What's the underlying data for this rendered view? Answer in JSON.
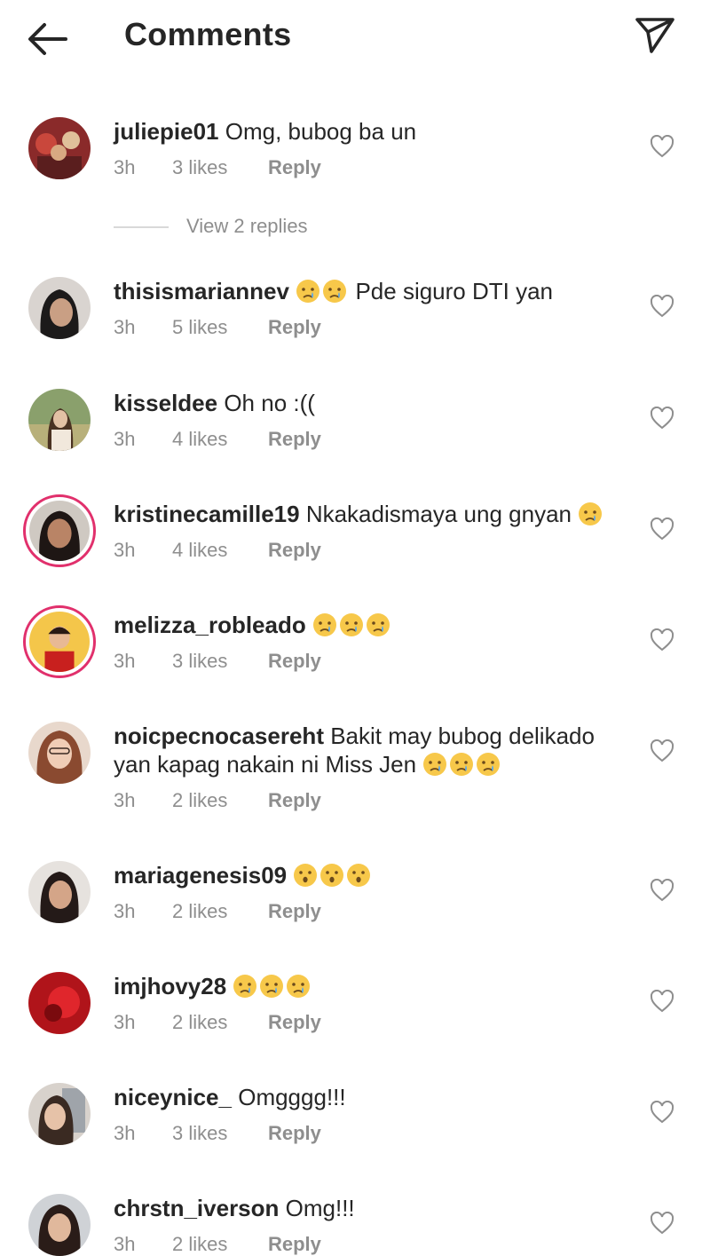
{
  "header": {
    "title": "Comments",
    "back_icon": "arrow-left-icon",
    "send_icon": "paper-plane-icon"
  },
  "comments": [
    {
      "username": "juliepie01",
      "text": "Omg, bubog ba un",
      "emojis": 0,
      "emoji_type": "",
      "time": "3h",
      "likes": "3 likes",
      "reply": "Reply",
      "story_ring": false,
      "replies_label": "View 2 replies"
    },
    {
      "username": "thisismariannev",
      "text": "Pde siguro DTI yan",
      "emojis": 2,
      "emoji_type": "crying-face-emoji",
      "time": "3h",
      "likes": "5 likes",
      "reply": "Reply",
      "story_ring": false
    },
    {
      "username": "kisseldee",
      "text": "Oh no :((",
      "emojis": 0,
      "emoji_type": "",
      "time": "3h",
      "likes": "4 likes",
      "reply": "Reply",
      "story_ring": false
    },
    {
      "username": "kristinecamille19",
      "text": "Nkakadismaya ung gnyan",
      "emojis": 1,
      "emoji_type": "crying-face-emoji",
      "time": "3h",
      "likes": "4 likes",
      "reply": "Reply",
      "story_ring": true
    },
    {
      "username": "melizza_robleado",
      "text": "",
      "emojis": 3,
      "emoji_type": "crying-face-emoji",
      "time": "3h",
      "likes": "3 likes",
      "reply": "Reply",
      "story_ring": true
    },
    {
      "username": "noicpecnocasereht",
      "text": "Bakit may bubog delikado",
      "text_line2": "yan kapag nakain ni Miss Jen",
      "emojis": 3,
      "emoji_type": "crying-face-emoji",
      "time": "3h",
      "likes": "2 likes",
      "reply": "Reply",
      "story_ring": false
    },
    {
      "username": "mariagenesis09",
      "text": "",
      "emojis": 3,
      "emoji_type": "hushed-face-emoji",
      "time": "3h",
      "likes": "2 likes",
      "reply": "Reply",
      "story_ring": false
    },
    {
      "username": "imjhovy28",
      "text": "",
      "emojis": 3,
      "emoji_type": "crying-face-emoji",
      "time": "3h",
      "likes": "2 likes",
      "reply": "Reply",
      "story_ring": false
    },
    {
      "username": "niceynice_",
      "text": "Omgggg!!!",
      "emojis": 0,
      "emoji_type": "",
      "time": "3h",
      "likes": "3 likes",
      "reply": "Reply",
      "story_ring": false
    },
    {
      "username": "chrstn_iverson",
      "text": "Omg!!!",
      "emojis": 0,
      "emoji_type": "",
      "time": "3h",
      "likes": "2 likes",
      "reply": "Reply",
      "story_ring": false
    }
  ],
  "colors": {
    "text": "#262626",
    "secondary": "#8e8e8e",
    "story_ring": "#e1306c"
  }
}
